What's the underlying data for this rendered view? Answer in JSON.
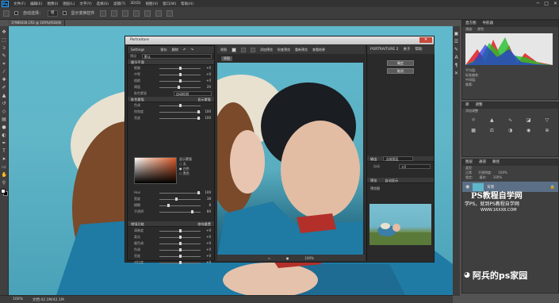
{
  "menubar": {
    "logo": "Ps",
    "items": [
      "文件(F)",
      "编辑(E)",
      "图像(I)",
      "图层(L)",
      "文字(Y)",
      "选择(S)",
      "滤镜(T)",
      "3D(D)",
      "视图(V)",
      "窗口(W)",
      "帮助(H)"
    ],
    "win": [
      "─",
      "□",
      "✕"
    ]
  },
  "options": {
    "autoselect": "自动选择：",
    "group": "组",
    "transform": "显示变换控件"
  },
  "doctab": {
    "title": "1Y9B6028.CR2 @ 100%(RGB/8)"
  },
  "status": {
    "zoom": "100%",
    "doc": "文档:42.1M/42.1M"
  },
  "portraiture": {
    "title": "Portraiture",
    "close": "✕",
    "settings_label": "Settings",
    "save": "保存",
    "delete": "删除",
    "preset_label": "预设",
    "preset_value": "默认",
    "detail_header": "细节平滑",
    "detail": [
      {
        "label": "细腻",
        "value": "+0"
      },
      {
        "label": "中等",
        "value": "+0"
      },
      {
        "label": "粗糙",
        "value": "+0"
      },
      {
        "label": "阈值",
        "value": "20"
      }
    ],
    "mask_mode_label": "肤色蒙版",
    "mask_mode_value": "自动检测",
    "skin_header": "肤色蒙版",
    "skin_show": "显示蒙版",
    "skin_sliders": [
      {
        "label": "色调",
        "value": ""
      },
      {
        "label": "饱和度",
        "value": "100"
      },
      {
        "label": "亮度",
        "value": "100"
      }
    ],
    "color_options": [
      "显示蒙版",
      "无",
      "白色",
      "黑色"
    ],
    "hue_sliders": [
      {
        "label": "Hue",
        "value": "100"
      },
      {
        "label": "宽度",
        "value": "38"
      },
      {
        "label": "模糊",
        "value": "8"
      },
      {
        "label": "不透明",
        "value": "80"
      }
    ],
    "enhance_header": "增强功能",
    "enhance_reset": "修饰重置",
    "enhance": [
      {
        "label": "清晰度",
        "value": "+0"
      },
      {
        "label": "柔化",
        "value": "+0"
      },
      {
        "label": "暖色调",
        "value": "+0"
      },
      {
        "label": "色调",
        "value": "+0"
      },
      {
        "label": "亮度",
        "value": "+0"
      },
      {
        "label": "对比度",
        "value": "+0"
      }
    ],
    "center_tabs": [
      "视图",
      "分割视图",
      "画面"
    ],
    "center_extra": [
      "添加预览",
      "检查预览",
      "重新预览",
      "查看结果"
    ],
    "center_tab": "原图",
    "zoom": "100%",
    "brand": "PORTRAITURE 2",
    "about": "关于",
    "help": "帮助",
    "ok": "确定",
    "cancel": "取消",
    "output_label": "输出",
    "output_value": "当前图层",
    "auto_label": "自动",
    "auto_value": "+0",
    "preview_label": "预览",
    "autoprev": "自动显示",
    "preview_title": "预览图"
  },
  "histogram": {
    "tab1": "直方图",
    "tab2": "导航器",
    "channel": "通道:",
    "channel_value": "颜色",
    "stats": [
      "平均值:",
      "标准偏差:",
      "中间值:",
      "像素:",
      "色阶:",
      "数量:",
      "百分位:",
      "高速缓存级别:"
    ]
  },
  "adjust": {
    "tab1": "库",
    "tab2": "调整",
    "add": "添加调整"
  },
  "layers": {
    "tab1": "图层",
    "tab2": "通道",
    "tab3": "路径",
    "kind": "类型",
    "mode": "正常",
    "opacity_label": "不透明度:",
    "opacity": "100%",
    "lock": "锁定:",
    "fill_label": "填充:",
    "fill": "100%",
    "layer_name": "背景"
  },
  "watermark": {
    "line1": "PS教程自学网",
    "line2": "学PS，就到PS教程自学网",
    "line3": "WWW.16XX8.COM",
    "wechat": "阿兵的ps家园"
  }
}
